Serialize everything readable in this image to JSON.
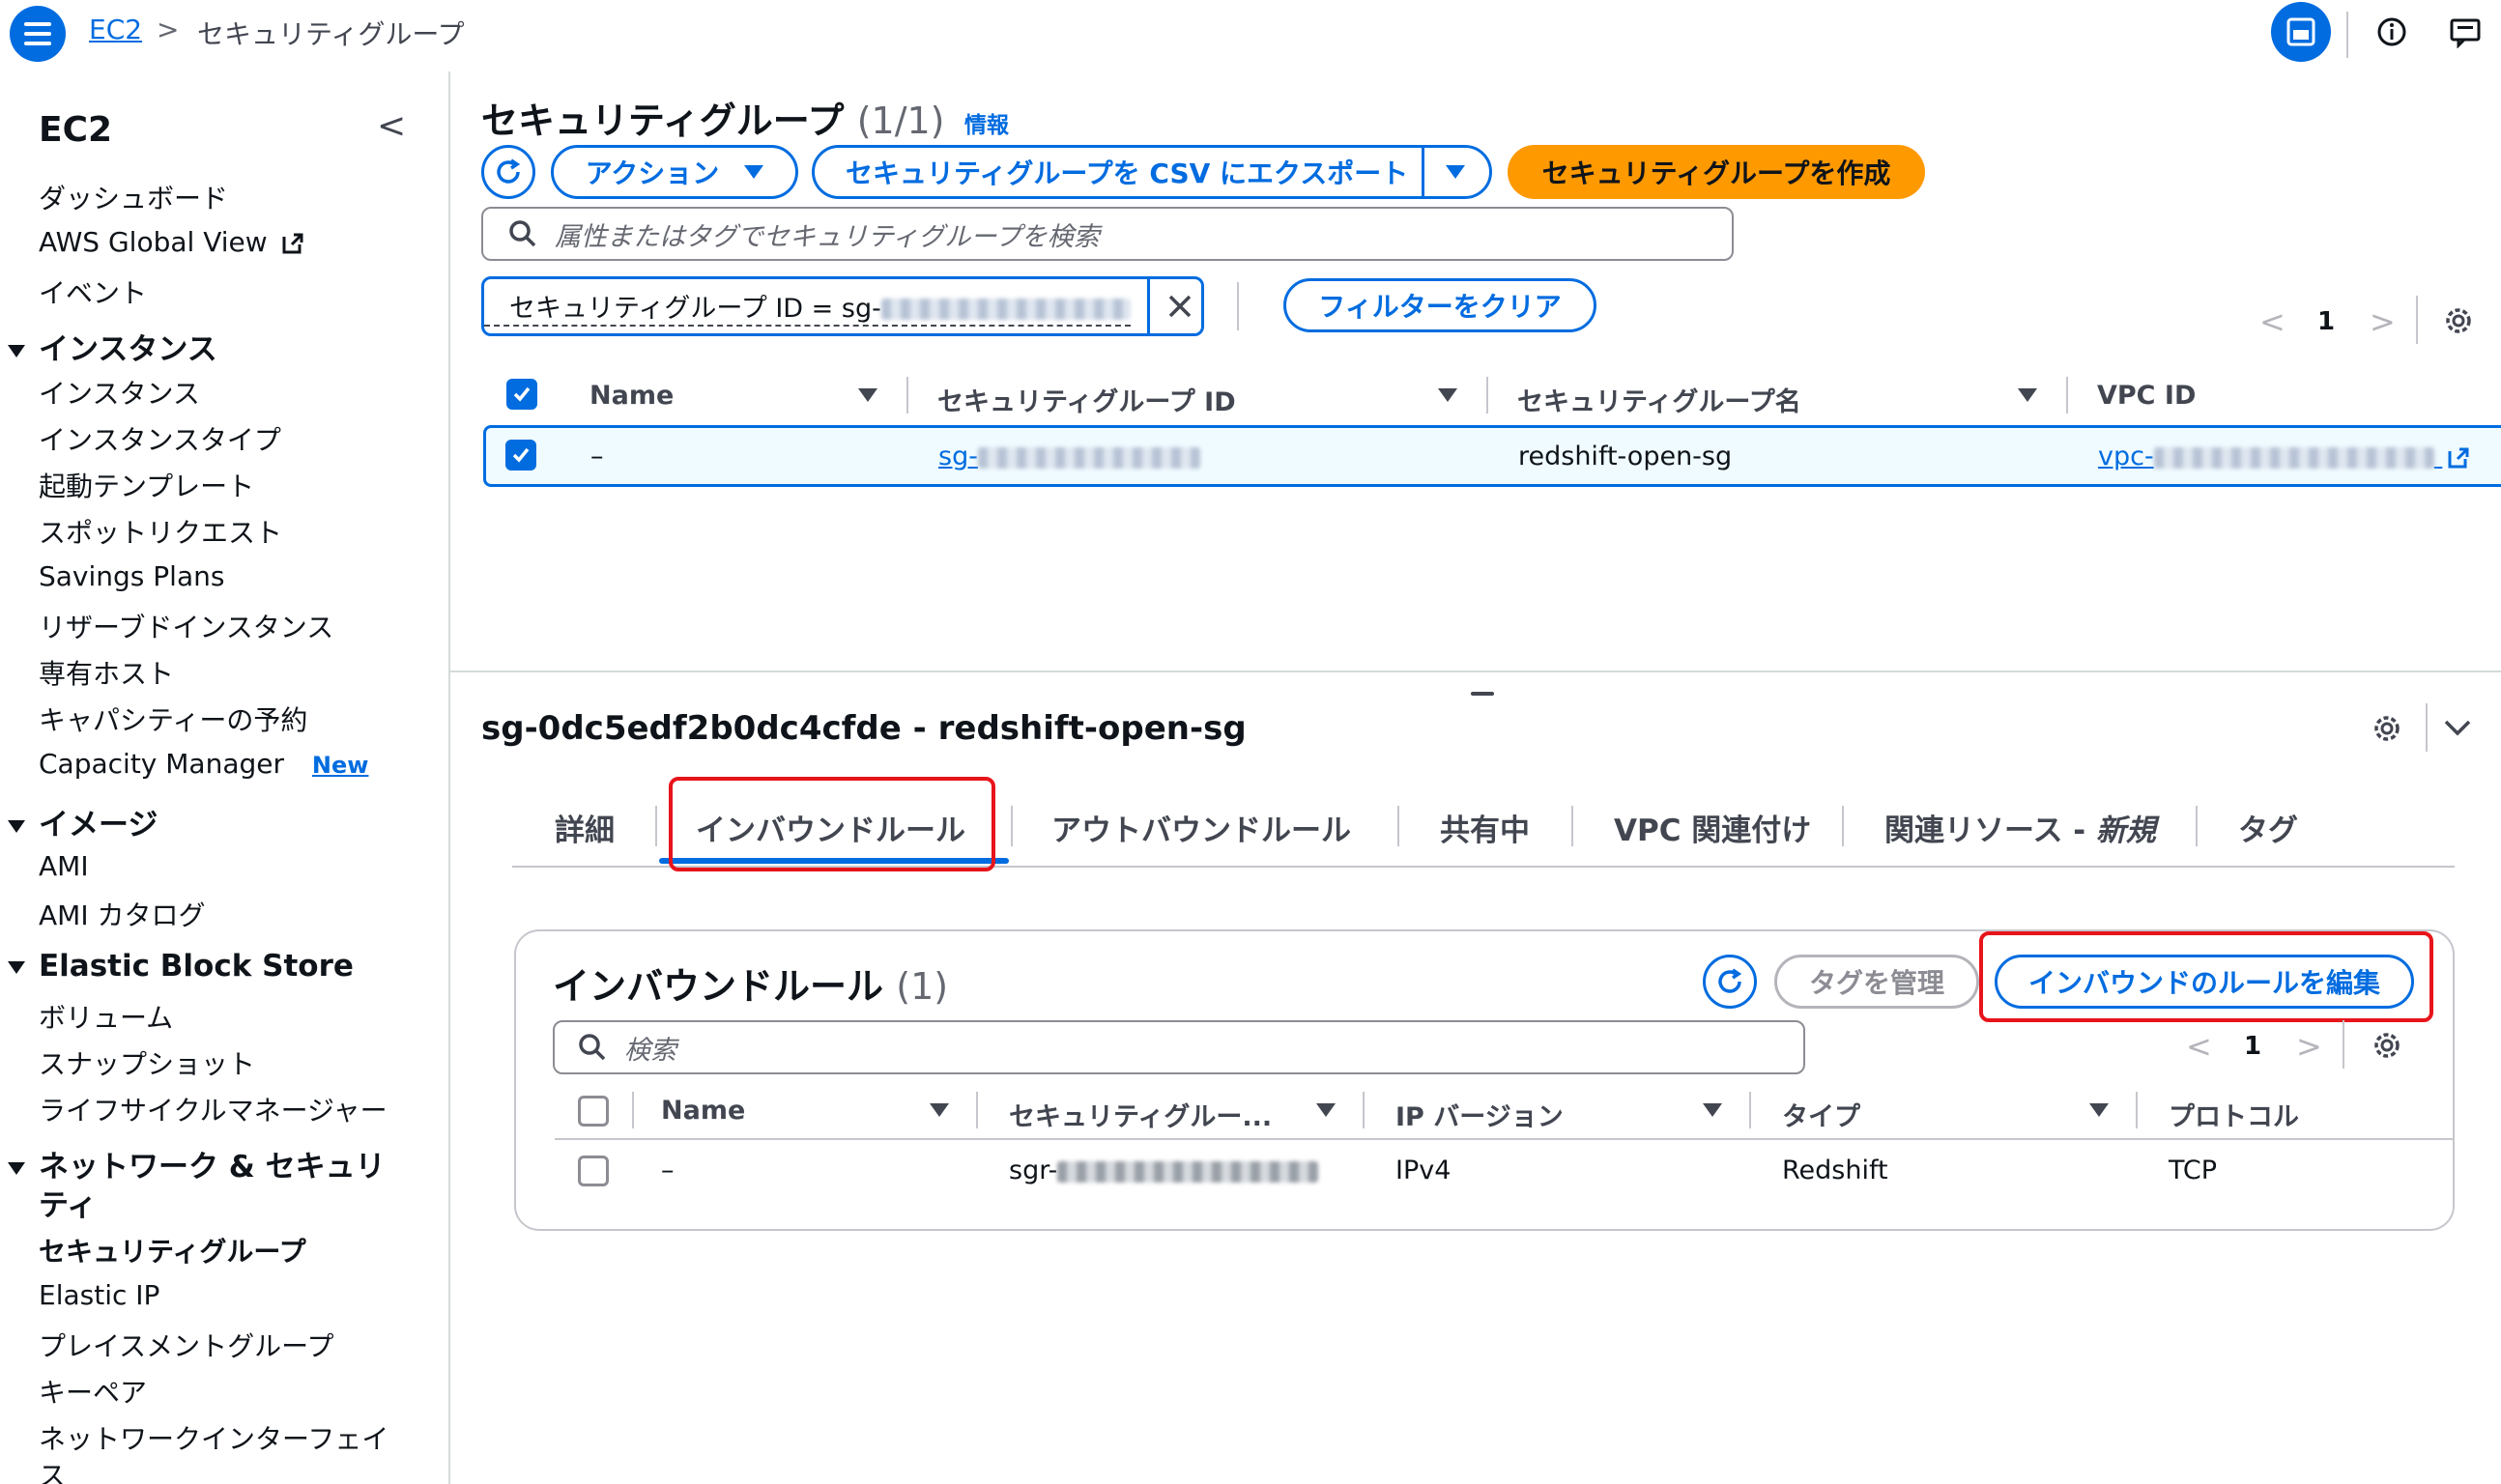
{
  "breadcrumb": {
    "root": "EC2",
    "current": "セキュリティグループ"
  },
  "sidebar": {
    "title": "EC2",
    "top_items": [
      "ダッシュボード",
      "AWS Global View",
      "イベント"
    ],
    "sections": {
      "instances": {
        "label": "インスタンス",
        "items": [
          "インスタンス",
          "インスタンスタイプ",
          "起動テンプレート",
          "スポットリクエスト",
          "Savings Plans",
          "リザーブドインスタンス",
          "専有ホスト",
          "キャパシティーの予約",
          "Capacity Manager"
        ]
      },
      "capacity_new_badge": "New",
      "images": {
        "label": "イメージ",
        "items": [
          "AMI",
          "AMI カタログ"
        ]
      },
      "ebs": {
        "label": "Elastic Block Store",
        "items": [
          "ボリューム",
          "スナップショット",
          "ライフサイクルマネージャー"
        ]
      },
      "network": {
        "label_line1": "ネットワーク & セキュリ",
        "label_line2": "ティ",
        "items": [
          "セキュリティグループ",
          "Elastic IP",
          "プレイスメントグループ",
          "キーペア",
          "ネットワークインターフェイ",
          "ス"
        ]
      }
    }
  },
  "header": {
    "title": "セキュリティグループ",
    "count": "(1/1)",
    "info_link": "情報",
    "actions_button": "アクション",
    "export_button": "セキュリティグループを CSV にエクスポート",
    "create_button": "セキュリティグループを作成",
    "search_placeholder": "属性またはタグでセキュリティグループを検索",
    "filter_token": "セキュリティグループ ID = sg-",
    "clear_filters": "フィルターをクリア",
    "page": "1"
  },
  "sg_table": {
    "columns": [
      "Name",
      "セキュリティグループ ID",
      "セキュリティグループ名",
      "VPC ID"
    ],
    "row": {
      "name": "–",
      "sg_id_prefix": "sg-",
      "sg_name": "redshift-open-sg",
      "vpc_prefix": "vpc-"
    }
  },
  "detail": {
    "title": "sg-0dc5edf2b0dc4cfde - redshift-open-sg",
    "tabs": [
      "詳細",
      "インバウンドルール",
      "アウトバウンドルール",
      "共有中",
      "VPC 関連付け",
      "関連リソース - ",
      "タグ"
    ],
    "tab_new_suffix": "新規",
    "inbound": {
      "title": "インバウンドルール",
      "count": "(1)",
      "manage_tags": "タグを管理",
      "edit_button": "インバウンドのルールを編集",
      "search_placeholder": "検索",
      "page": "1",
      "columns": [
        "Name",
        "セキュリティグルー...",
        "IP バージョン",
        "タイプ",
        "プロトコル"
      ],
      "row": {
        "name": "–",
        "rule_id_prefix": "sgr-",
        "ip_version": "IPv4",
        "type": "Redshift",
        "protocol": "TCP"
      }
    }
  },
  "colors": {
    "accent": "#006ce0",
    "primary": "#ff9900",
    "highlight": "#e8141b"
  }
}
